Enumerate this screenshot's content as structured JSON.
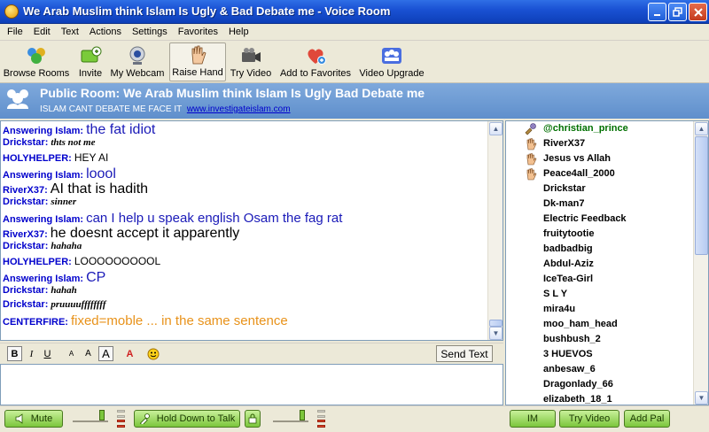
{
  "window": {
    "title": "We Arab Muslim think Islam Is Ugly & Bad Debate me - Voice Room"
  },
  "menu": [
    "File",
    "Edit",
    "Text",
    "Actions",
    "Settings",
    "Favorites",
    "Help"
  ],
  "toolbar": {
    "browse": "Browse Rooms",
    "invite": "Invite",
    "webcam": "My Webcam",
    "raise_hand": "Raise Hand",
    "try_video": "Try Video",
    "favorites": "Add to Favorites",
    "upgrade": "Video Upgrade"
  },
  "room": {
    "title": "Public Room: We Arab Muslim think Islam Is Ugly  Bad Debate me",
    "subtitle": "ISLAM CANT DEBATE ME FACE IT",
    "link": "www.investigateislam.com"
  },
  "chat": [
    {
      "nick": "Answering Islam:",
      "text": "the fat idiot",
      "color": "#1a1ab8",
      "size": 16,
      "font": "sans",
      "style": "normal"
    },
    {
      "nick": "Drickstar:",
      "text": "thts not me",
      "color": "#000000",
      "size": 11,
      "font": "serif",
      "style": "bold-italic"
    },
    {
      "nick": "HOLYHELPER:",
      "text": "HEY AI",
      "color": "#000000",
      "size": 12,
      "font": "sans",
      "style": "normal"
    },
    {
      "nick": "Answering Islam:",
      "text": "loool",
      "color": "#1a1ab8",
      "size": 16,
      "font": "sans",
      "style": "normal"
    },
    {
      "nick": "RiverX37:",
      "text": "AI  that is hadith",
      "color": "#000000",
      "size": 16,
      "font": "sans",
      "style": "normal"
    },
    {
      "nick": "Drickstar:",
      "text": "sinner",
      "color": "#000000",
      "size": 11,
      "font": "serif",
      "style": "bold-italic"
    },
    {
      "nick": "Answering Islam:",
      "text": "can I help u speak english Osam the fag rat",
      "color": "#1a1ab8",
      "size": 15,
      "font": "sans",
      "style": "normal"
    },
    {
      "nick": "RiverX37:",
      "text": "he doesnt accept it apparently",
      "color": "#000000",
      "size": 16,
      "font": "sans",
      "style": "normal"
    },
    {
      "nick": "Drickstar:",
      "text": " hahaha",
      "color": "#000000",
      "size": 11,
      "font": "serif",
      "style": "bold-italic"
    },
    {
      "nick": "HOLYHELPER:",
      "text": "LOOOOOOOOOL",
      "color": "#000000",
      "size": 12,
      "font": "sans",
      "style": "normal"
    },
    {
      "nick": "Answering Islam:",
      "text": "CP",
      "color": "#1a1ab8",
      "size": 16,
      "font": "sans",
      "style": "normal"
    },
    {
      "nick": "Drickstar:",
      "text": "hahah",
      "color": "#000000",
      "size": 11,
      "font": "serif",
      "style": "bold-italic"
    },
    {
      "nick": "Drickstar:",
      "text": "pruuuuffffffff",
      "color": "#000000",
      "size": 11,
      "font": "serif",
      "style": "bold-italic"
    },
    {
      "nick": "CENTERFIRE:",
      "text": "fixed=moble ... in the same sentence",
      "color": "#e8921a",
      "size": 15,
      "font": "sans",
      "style": "normal"
    }
  ],
  "format": {
    "bold": "B",
    "italic": "I",
    "underline": "U",
    "size_small": "A",
    "size_medium": "A",
    "size_large": "A",
    "color": "A",
    "send": "Send Text"
  },
  "users": [
    {
      "name": "@christian_prince",
      "icon": "mic-icon",
      "op": true
    },
    {
      "name": "RiverX37",
      "icon": "hand-icon",
      "op": false
    },
    {
      "name": "Jesus vs Allah",
      "icon": "hand-icon",
      "op": false
    },
    {
      "name": "Peace4all_2000",
      "icon": "hand-icon",
      "op": false
    },
    {
      "name": "Drickstar",
      "icon": "",
      "op": false
    },
    {
      "name": "Dk-man7",
      "icon": "",
      "op": false
    },
    {
      "name": "Electric Feedback",
      "icon": "",
      "op": false
    },
    {
      "name": "fruitytootie",
      "icon": "",
      "op": false
    },
    {
      "name": "badbadbig",
      "icon": "",
      "op": false
    },
    {
      "name": "Abdul-Aziz",
      "icon": "",
      "op": false
    },
    {
      "name": "IceTea-Girl",
      "icon": "",
      "op": false
    },
    {
      "name": "S L Y",
      "icon": "",
      "op": false
    },
    {
      "name": "mira4u",
      "icon": "",
      "op": false
    },
    {
      "name": "moo_ham_head",
      "icon": "",
      "op": false
    },
    {
      "name": "bushbush_2",
      "icon": "",
      "op": false
    },
    {
      "name": "3 HUEVOS",
      "icon": "",
      "op": false
    },
    {
      "name": "anbesaw_6",
      "icon": "",
      "op": false
    },
    {
      "name": "Dragonlady_66",
      "icon": "",
      "op": false
    },
    {
      "name": "elizabeth_18_1",
      "icon": "",
      "op": false
    }
  ],
  "bottom": {
    "mute": "Mute",
    "talk": "Hold Down to Talk",
    "im": "IM",
    "try_video": "Try Video",
    "add_pal": "Add Pal"
  }
}
